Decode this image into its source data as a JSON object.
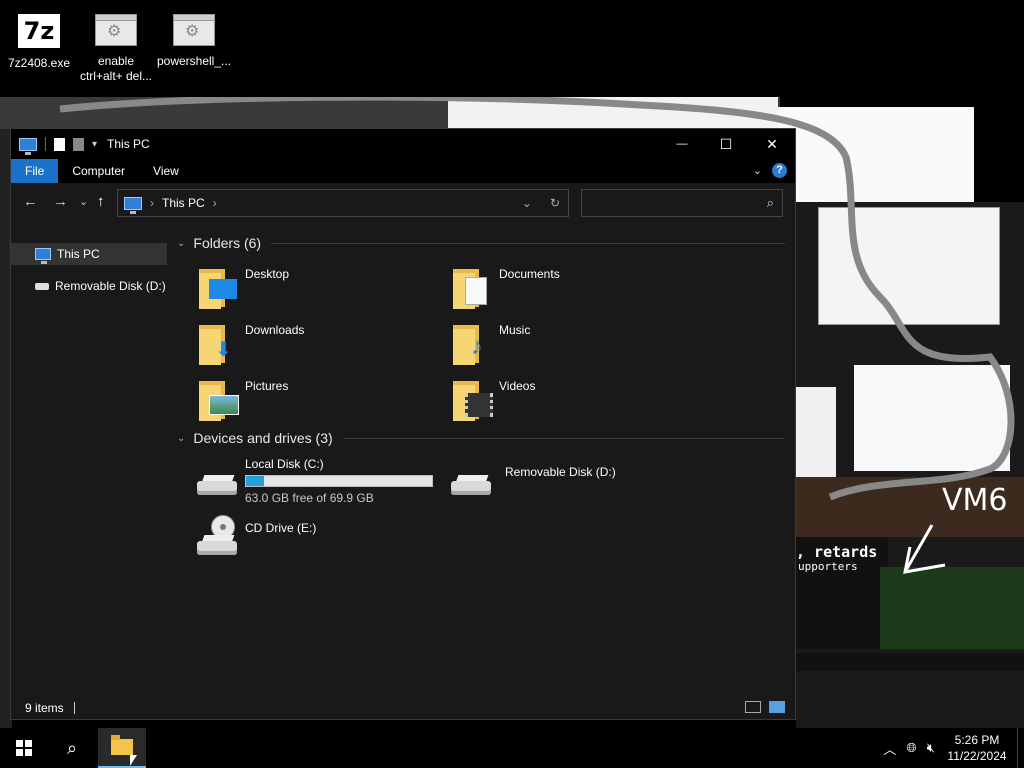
{
  "desktop": {
    "icons": [
      {
        "label": "7z2408.exe",
        "glyph": "7z"
      },
      {
        "label": "enable ctrl+alt+ del...",
        "glyph": "⚙"
      },
      {
        "label": "powershell_...",
        "glyph": "⚙"
      }
    ],
    "collage_text": {
      "vm6": "VM6",
      "retards": ", retards",
      "supporters": "upporters"
    }
  },
  "window": {
    "title": "This PC",
    "controls": {
      "minimize": "—",
      "maximize": "☐",
      "close": "✕"
    },
    "ribbon_tabs": [
      "File",
      "Computer",
      "View"
    ],
    "help": "?",
    "nav": {
      "back": "←",
      "forward": "→",
      "recent": "⌄",
      "up": "↑"
    },
    "address": {
      "crumb": "This PC",
      "dropdown": "⌄",
      "refresh": "↻"
    },
    "search": {
      "placeholder": "",
      "icon": "⌕"
    },
    "sidebar": [
      {
        "label": "This PC",
        "icon": "pc-icon",
        "selected": true
      },
      {
        "label": "Removable Disk (D:)",
        "icon": "drive-icon",
        "selected": false
      }
    ],
    "folders_header": "Folders (6)",
    "folders": [
      {
        "label": "Desktop",
        "badge": "▬"
      },
      {
        "label": "Documents",
        "badge": "≡"
      },
      {
        "label": "Downloads",
        "badge": "⬇"
      },
      {
        "label": "Music",
        "badge": "♪"
      },
      {
        "label": "Pictures",
        "badge": "▭"
      },
      {
        "label": "Videos",
        "badge": "▦"
      }
    ],
    "drives_header": "Devices and drives (3)",
    "drives": [
      {
        "label": "Local Disk (C:)",
        "free_text": "63.0 GB free of 69.9 GB",
        "used_fraction": 0.099
      },
      {
        "label": "Removable Disk (D:)"
      },
      {
        "label": "CD Drive (E:)"
      }
    ],
    "status": {
      "count": "9 items"
    }
  },
  "taskbar": {
    "time": "5:26 PM",
    "date": "11/22/2024",
    "tray_icons": [
      "chevron-up-icon",
      "globe-icon",
      "volume-muted-icon"
    ]
  },
  "colors": {
    "accent": "#1a73c9",
    "folder": "#f7d574",
    "usage_fill": "#26a0da"
  }
}
